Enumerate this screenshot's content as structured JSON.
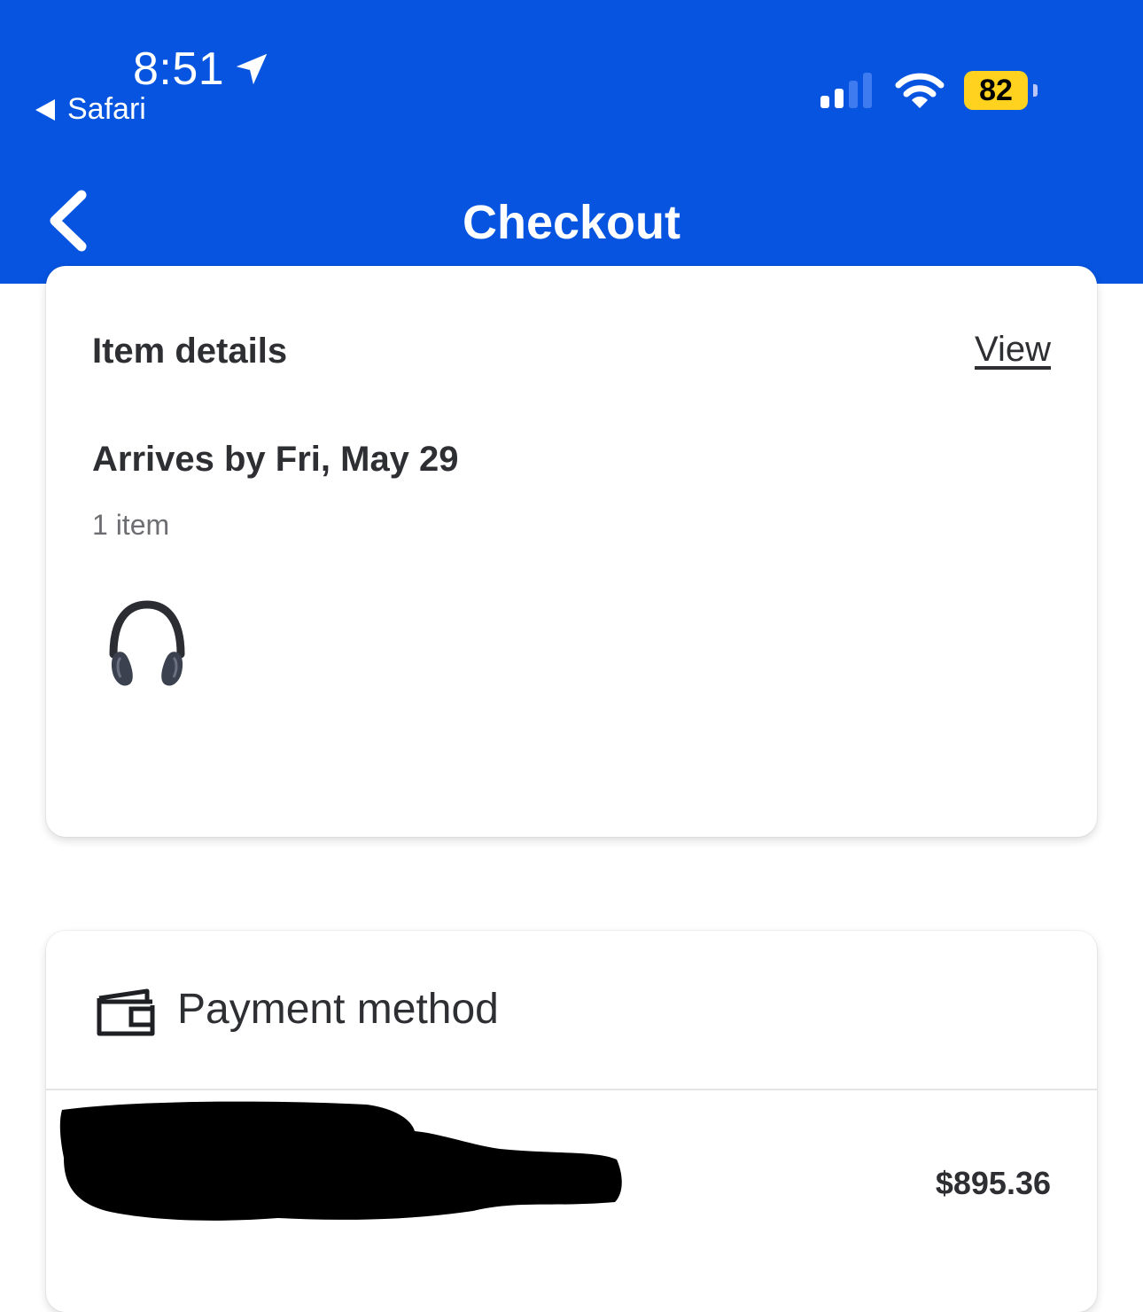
{
  "status_bar": {
    "time": "8:51",
    "back_app": "Safari",
    "battery": "82"
  },
  "nav": {
    "title": "Checkout"
  },
  "item_details": {
    "title": "Item details",
    "view_label": "View",
    "arrival": "Arrives by Fri, May 29",
    "count": "1 item"
  },
  "payment": {
    "title": "Payment method",
    "amount": "$895.36"
  },
  "colors": {
    "header_bg": "#0654e0",
    "battery": "#ffd21f",
    "text_primary": "#2e2f32",
    "text_secondary": "#6d6e71"
  },
  "icons": {
    "location": "location-arrow-icon",
    "signal": "cellular-signal-icon",
    "wifi": "wifi-icon",
    "battery": "battery-icon",
    "back": "chevron-left-icon",
    "product": "headphones-icon",
    "payment": "wallet-icon"
  }
}
